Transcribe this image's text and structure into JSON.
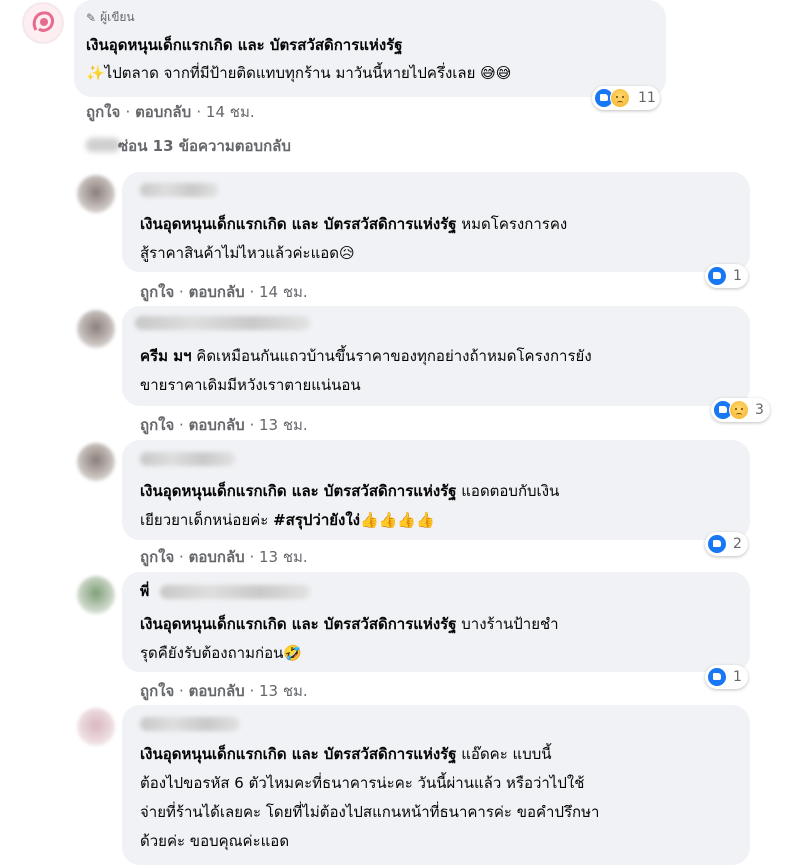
{
  "top_comment": {
    "badge": "ผู้เขียน",
    "page_name": "เงินอุดหนุนเด็กแรกเกิด และ บัตรสวัสดิการแห่งรัฐ",
    "text": "✨ไปตลาด จากที่มีป้ายติดแทบทุกร้าน มาวันนี้หายไปครึ่งเลย 😅😅",
    "like": "ถูกใจ",
    "reply": "ตอบกลับ",
    "time": "14 ชม.",
    "reaction_count": "11"
  },
  "hide_replies": "ซ่อน 13 ข้อความตอบกลับ",
  "replies": [
    {
      "author": "",
      "tag": "เงินอุดหนุนเด็กแรกเกิด และ บัตรสวัสดิการแห่งรัฐ",
      "line1": " หมดโครงการคง",
      "line2": "สู้ราคาสินค้าไม่ไหวแล้วค่ะแอด😥",
      "like": "ถูกใจ",
      "reply": "ตอบกลับ",
      "time": "14 ชม.",
      "reaction_count": "1"
    },
    {
      "author": "",
      "tag": "ครีม มฯ",
      "line1": " คิดเหมือนกันแถวบ้านขึ้นราคาของทุกอย่างถ้าหมดโครงการยัง",
      "line2": "ขายราคาเดิมมีหวังเราตายแน่นอน",
      "like": "ถูกใจ",
      "reply": "ตอบกลับ",
      "time": "13 ชม.",
      "reaction_count": "3"
    },
    {
      "author": "",
      "tag": "เงินอุดหนุนเด็กแรกเกิด และ บัตรสวัสดิการแห่งรัฐ",
      "line1": " แอดตอบกับเงิน",
      "line2a": "เยียวยาเด็กหน่อยค่ะ ",
      "line2b": "#สรุปว่ายังใง่",
      "line2c": "👍👍👍👍",
      "like": "ถูกใจ",
      "reply": "ตอบกลับ",
      "time": "13 ชม.",
      "reaction_count": "2"
    },
    {
      "author": "พี่",
      "tag": "เงินอุดหนุนเด็กแรกเกิด และ บัตรสวัสดิการแห่งรัฐ",
      "line1": " บางร้านป้ายชำ",
      "line2": "รุดคืยังรับต้องถามก่อน🤣",
      "like": "ถูกใจ",
      "reply": "ตอบกลับ",
      "time": "13 ชม.",
      "reaction_count": "1"
    },
    {
      "author": "",
      "tag": "เงินอุดหนุนเด็กแรกเกิด และ บัตรสวัสดิการแห่งรัฐ",
      "line1": " แอ๊ดคะ แบบนี้",
      "line2": "ต้องไปขอรหัส 6 ตัวไหมคะที่ธนาคารน่ะคะ วันนี้ผ่านแล้ว หรือว่าไปใช้",
      "line3": "จ่ายที่ร้านได้เลยคะ โดยที่ไม่ต้องไปสแกนหน้าที่ธนาคารค่ะ ขอคำปรึกษา",
      "line4": "ด้วยค่ะ ขอบคุณค่ะแอด"
    }
  ]
}
